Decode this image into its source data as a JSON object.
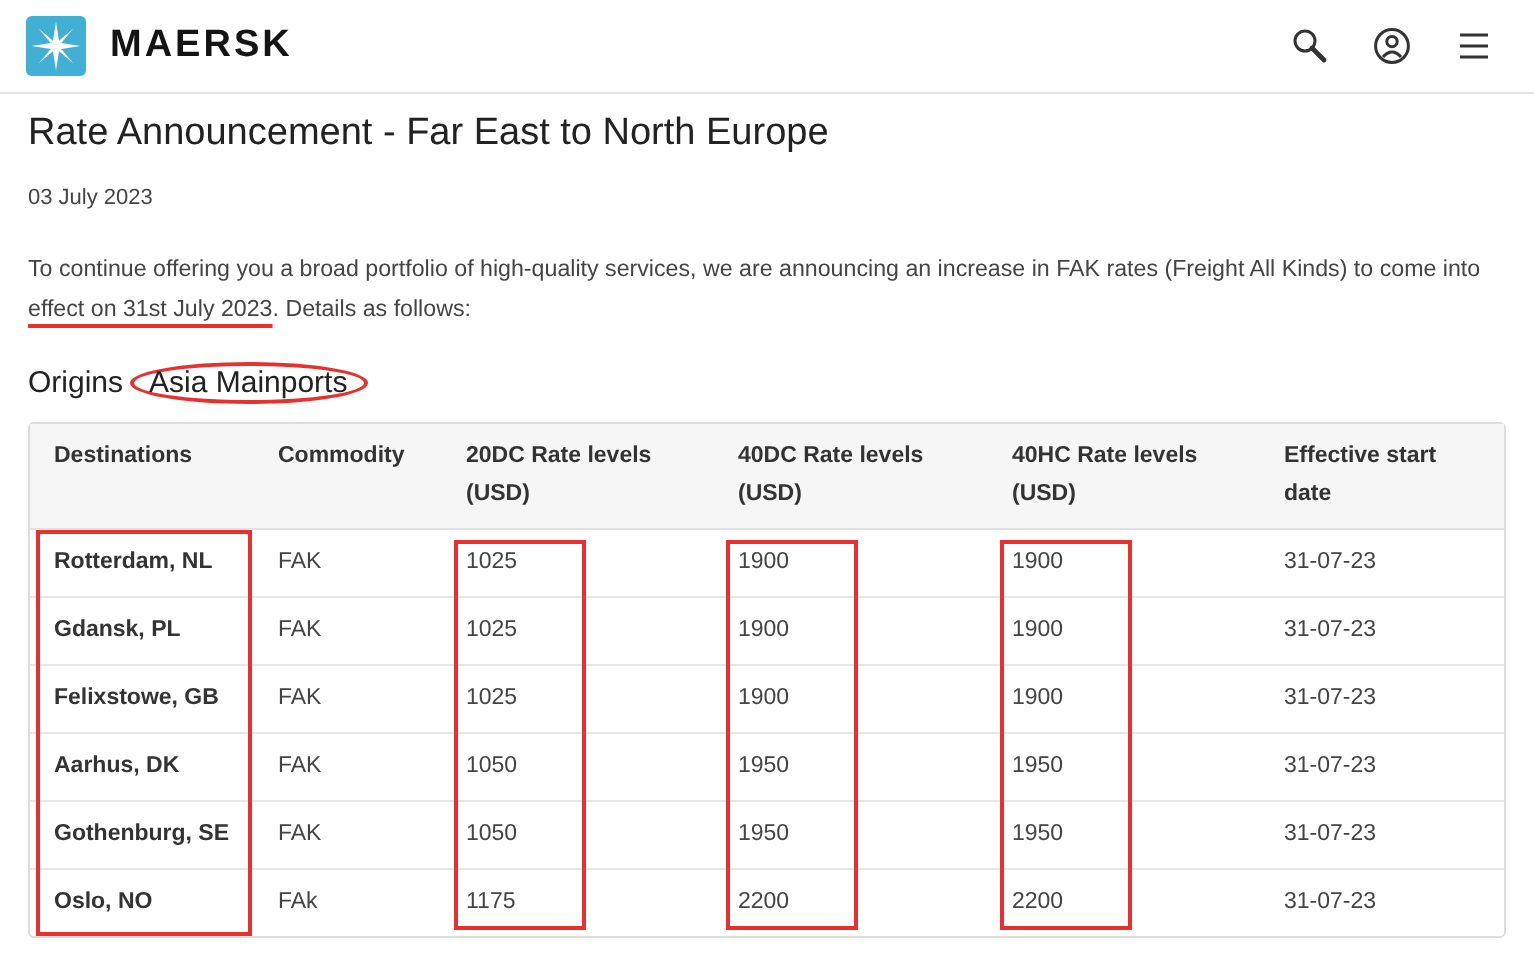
{
  "header": {
    "brand": "MAERSK"
  },
  "title": "Rate Announcement - Far East to North Europe",
  "date": "03 July 2023",
  "intro": {
    "before": "To continue offering you a broad portfolio of high-quality services, we are announcing an increase in FAK rates (Freight All Kinds) to come into ",
    "marked": "effect on 31st July 2023",
    "underlined": true,
    "after": ". Details as follows:"
  },
  "origins": {
    "label": "Origins",
    "value": "Asia Mainports",
    "circled": true
  },
  "table": {
    "columns": [
      {
        "label": "Destinations",
        "annotated": true
      },
      {
        "label": "Commodity",
        "annotated": false
      },
      {
        "label": "20DC Rate levels (USD)",
        "annotated": true
      },
      {
        "label": "40DC Rate levels (USD)",
        "annotated": true
      },
      {
        "label": "40HC Rate levels (USD)",
        "annotated": true
      },
      {
        "label": "Effective start date",
        "annotated": false
      }
    ],
    "rows": [
      [
        "Rotterdam, NL",
        "FAK",
        "1025",
        "1900",
        "1900",
        "31-07-23"
      ],
      [
        "Gdansk, PL",
        "FAK",
        "1025",
        "1900",
        "1900",
        "31-07-23"
      ],
      [
        "Felixstowe, GB",
        "FAK",
        "1025",
        "1900",
        "1900",
        "31-07-23"
      ],
      [
        "Aarhus, DK",
        "FAK",
        "1050",
        "1950",
        "1950",
        "31-07-23"
      ],
      [
        "Gothenburg, SE",
        "FAK",
        "1050",
        "1950",
        "1950",
        "31-07-23"
      ],
      [
        "Oslo, NO",
        "FAk",
        "1175",
        "2200",
        "2200",
        "31-07-23"
      ]
    ]
  }
}
